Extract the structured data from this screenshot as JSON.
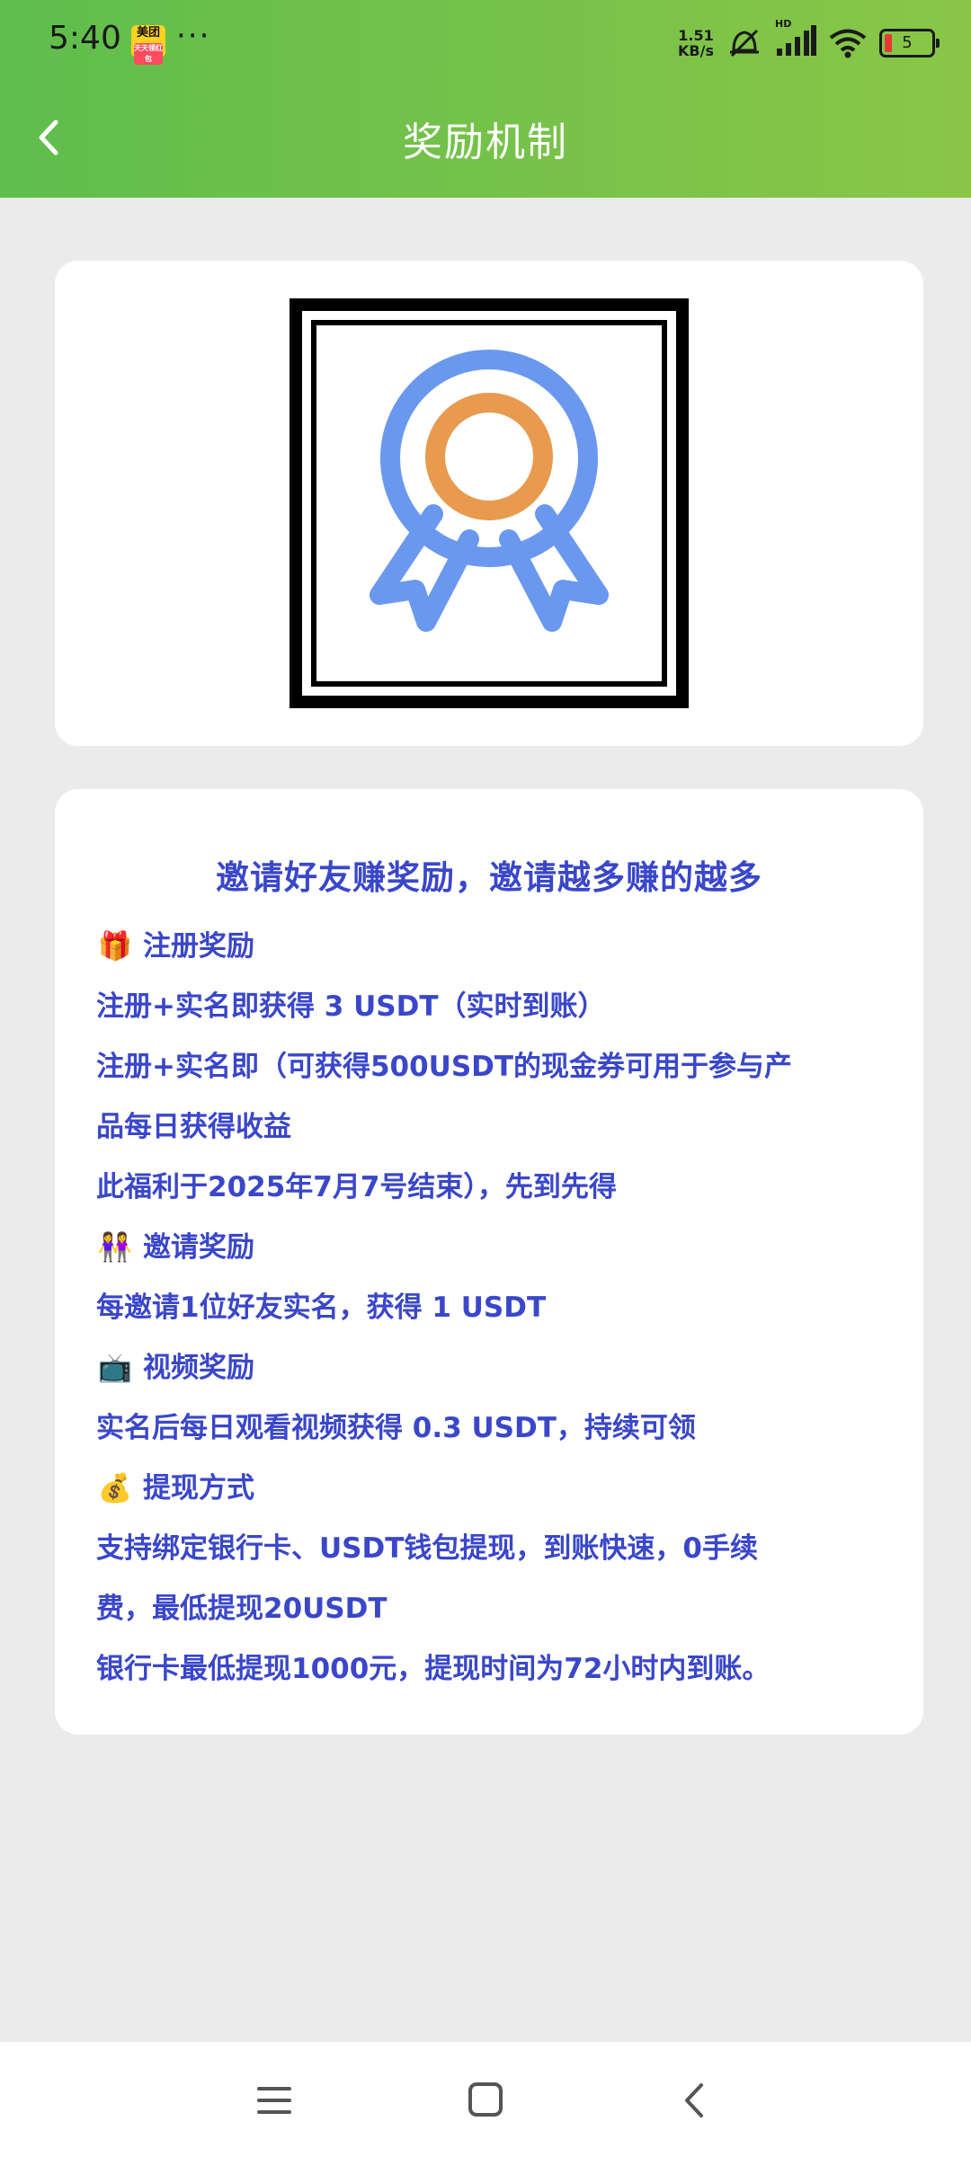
{
  "status_bar": {
    "time": "5:40",
    "app_badge": "美团",
    "app_badge_sub": "天天领红包",
    "more": "···",
    "net_speed_value": "1.51",
    "net_speed_unit": "KB/s",
    "signal_label": "HD",
    "battery_level": "5"
  },
  "header": {
    "title": "奖励机制",
    "back_icon": "chevron-left-icon"
  },
  "hero": {
    "icon": "award-badge-icon",
    "colors": {
      "ring": "#6a98ef",
      "center": "#e89a4e"
    }
  },
  "info": {
    "headline": "邀请好友赚奖励，邀请越多赚的越多",
    "lines": [
      {
        "emoji": "🎁",
        "text": "注册奖励"
      },
      {
        "emoji": "",
        "text": "注册+实名即获得 3 USDT（实时到账）"
      },
      {
        "emoji": "",
        "text": "注册+实名即（可获得500USDT的现金券可用于参与产"
      },
      {
        "emoji": "",
        "text": "品每日获得收益"
      },
      {
        "emoji": "",
        "text": "此福利于2025年7月7号结束），先到先得"
      },
      {
        "emoji": "👭",
        "text": "邀请奖励"
      },
      {
        "emoji": "",
        "text": "每邀请1位好友实名，获得 1 USDT"
      },
      {
        "emoji": "📺",
        "text": "视频奖励"
      },
      {
        "emoji": "",
        "text": "实名后每日观看视频获得 0.3 USDT，持续可领"
      },
      {
        "emoji": "💰",
        "text": "提现方式"
      },
      {
        "emoji": "",
        "text": "支持绑定银行卡、USDT钱包提现，到账快速，0手续"
      },
      {
        "emoji": "",
        "text": "费，最低提现20USDT"
      },
      {
        "emoji": "",
        "text": "银行卡最低提现1000元，提现时间为72小时内到账。"
      }
    ],
    "text_color": "#3a47c9"
  },
  "nav_bar": {
    "menu_icon": "menu-icon",
    "home_icon": "home-square-icon",
    "back_icon": "back-triangle-icon"
  }
}
